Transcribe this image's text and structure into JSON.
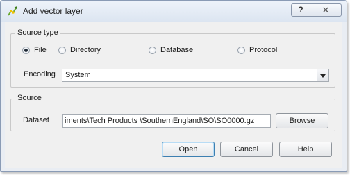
{
  "window": {
    "title": "Add vector layer",
    "help_button": "?",
    "close_button": "✕",
    "icon": "qgis-vector-layer-icon"
  },
  "source_type": {
    "legend": "Source type",
    "options": [
      {
        "label": "File",
        "selected": true
      },
      {
        "label": "Directory",
        "selected": false
      },
      {
        "label": "Database",
        "selected": false
      },
      {
        "label": "Protocol",
        "selected": false
      }
    ],
    "encoding_label": "Encoding",
    "encoding_value": "System"
  },
  "source": {
    "legend": "Source",
    "dataset_label": "Dataset",
    "dataset_value": "iments\\Tech Products \\SouthernEngland\\SO\\SO0000.gz",
    "browse_button": "Browse"
  },
  "buttons": {
    "open": "Open",
    "cancel": "Cancel",
    "help": "Help"
  }
}
